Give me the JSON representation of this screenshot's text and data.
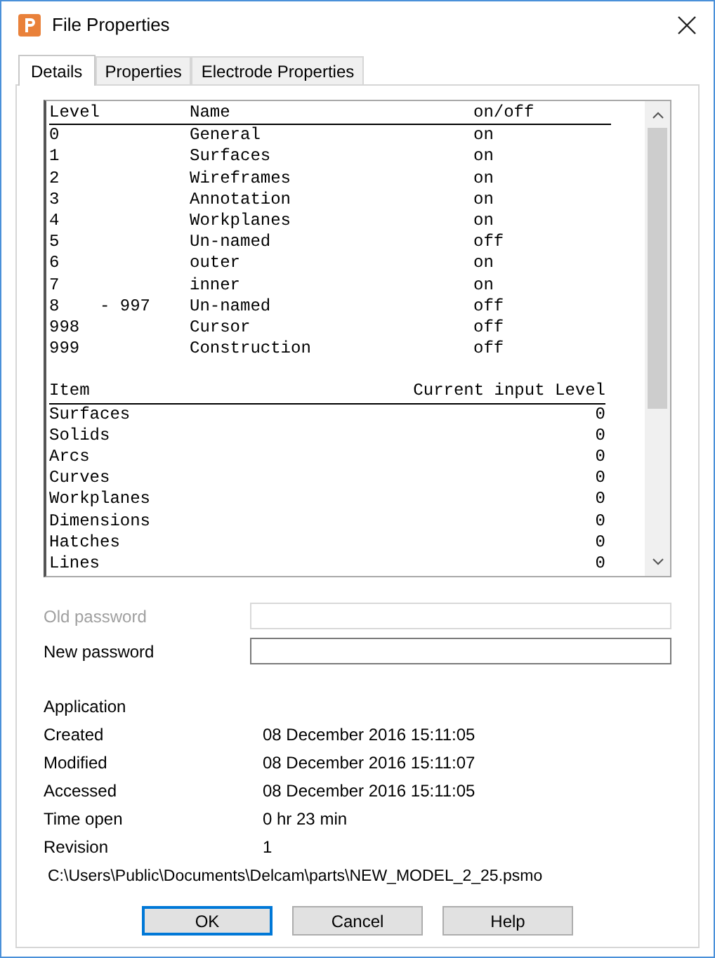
{
  "window": {
    "title": "File Properties"
  },
  "tabs": [
    {
      "label": "Details",
      "selected": true
    },
    {
      "label": "Properties",
      "selected": false
    },
    {
      "label": "Electrode Properties",
      "selected": false
    }
  ],
  "levels": {
    "columns": [
      "Level",
      "Name",
      "on/off"
    ],
    "rows": [
      {
        "level": "0",
        "name": "General",
        "state": "on"
      },
      {
        "level": "1",
        "name": "Surfaces",
        "state": "on"
      },
      {
        "level": "2",
        "name": "Wireframes",
        "state": "on"
      },
      {
        "level": "3",
        "name": "Annotation",
        "state": "on"
      },
      {
        "level": "4",
        "name": "Workplanes",
        "state": "on"
      },
      {
        "level": "5",
        "name": "Un-named",
        "state": "off"
      },
      {
        "level": "6",
        "name": "outer",
        "state": "on"
      },
      {
        "level": "7",
        "name": "inner",
        "state": "on"
      },
      {
        "level": "8    - 997",
        "name": "Un-named",
        "state": "off"
      },
      {
        "level": "998",
        "name": "Cursor",
        "state": "off"
      },
      {
        "level": "999",
        "name": "Construction",
        "state": "off"
      }
    ]
  },
  "items": {
    "columns": [
      "Item",
      "Current input Level"
    ],
    "rows": [
      {
        "item": "Surfaces",
        "level": "0"
      },
      {
        "item": "Solids",
        "level": "0"
      },
      {
        "item": "Arcs",
        "level": "0"
      },
      {
        "item": "Curves",
        "level": "0"
      },
      {
        "item": "Workplanes",
        "level": "0"
      },
      {
        "item": "Dimensions",
        "level": "0"
      },
      {
        "item": "Hatches",
        "level": "0"
      },
      {
        "item": "Lines",
        "level": "0"
      }
    ]
  },
  "passwords": [
    {
      "label": "Old password",
      "disabled": true
    },
    {
      "label": "New password",
      "disabled": false
    }
  ],
  "info": {
    "heading": "Application",
    "rows": [
      {
        "label": "Created",
        "value": "08 December 2016 15:11:05"
      },
      {
        "label": "Modified",
        "value": "08 December 2016 15:11:07"
      },
      {
        "label": "Accessed",
        "value": "08 December 2016 15:11:05"
      },
      {
        "label": "Time open",
        "value": "0 hr 23 min"
      },
      {
        "label": "Revision",
        "value": "1"
      }
    ],
    "path": "C:\\Users\\Public\\Documents\\Delcam\\parts\\NEW_MODEL_2_25.psmo"
  },
  "buttons": [
    {
      "label": "OK",
      "default": true
    },
    {
      "label": "Cancel",
      "default": false
    },
    {
      "label": "Help",
      "default": false
    }
  ]
}
